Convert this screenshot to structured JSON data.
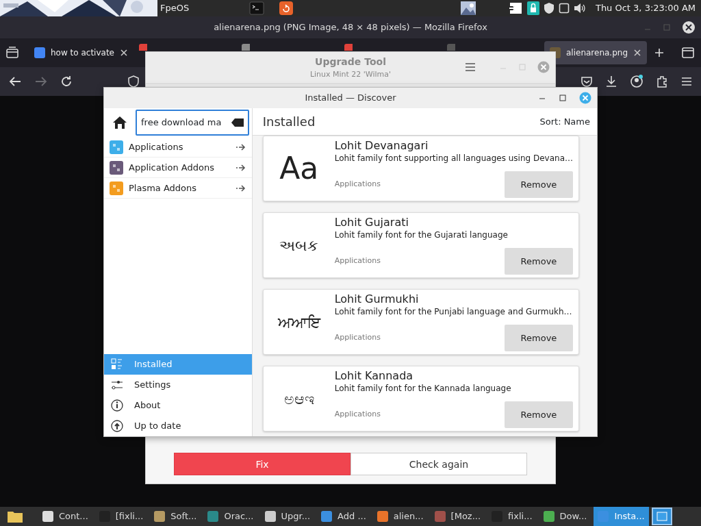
{
  "top_panel": {
    "app_label": "FpeOS",
    "clock": "Thu Oct 3, 3:23:00 AM"
  },
  "firefox": {
    "title": "alienarena.png (PNG Image, 48 × 48 pixels) — Mozilla Firefox",
    "tabs": [
      {
        "label": "how to activate",
        "selected": false,
        "color": "#4285f4"
      },
      {
        "selected": false,
        "color": "#e0413a"
      },
      {
        "selected": false,
        "color": "#8a8a8a"
      },
      {
        "selected": false,
        "color": "#e0413a"
      },
      {
        "selected": false,
        "color": "#555555"
      },
      {
        "label": "alienarena.png",
        "selected": true,
        "color": "#6b5a3a"
      }
    ]
  },
  "upgrade_tool": {
    "title": "Upgrade Tool",
    "subtitle": "Linux Mint 22 'Wilma'",
    "buttons": [
      {
        "label": "Fix",
        "kind": "danger"
      },
      {
        "label": "Check again",
        "kind": "plain"
      }
    ]
  },
  "discover": {
    "title": "Installed — Discover",
    "search": {
      "value": "free download ma"
    },
    "categories": [
      {
        "label": "Applications",
        "color": "#3daee9"
      },
      {
        "label": "Application Addons",
        "color": "#6a5a7a"
      },
      {
        "label": "Plasma Addons",
        "color": "#f39c1f"
      }
    ],
    "nav": [
      {
        "label": "Installed",
        "selected": true,
        "kind": "installed"
      },
      {
        "label": "Settings",
        "selected": false,
        "kind": "settings"
      },
      {
        "label": "About",
        "selected": false,
        "kind": "about"
      },
      {
        "label": "Up to date",
        "selected": false,
        "kind": "update"
      }
    ],
    "header": "Installed",
    "sort": "Sort: Name",
    "apps": [
      {
        "name": "Lohit Devanagari",
        "description": "Lohit family font supporting all languages using Devana…",
        "category": "Applications",
        "preview": "Aa",
        "action": "Remove"
      },
      {
        "name": "Lohit Gujarati",
        "description": "Lohit family font for the Gujarati language",
        "category": "Applications",
        "preview": "અબક",
        "action": "Remove"
      },
      {
        "name": "Lohit Gurmukhi",
        "description": "Lohit family font for the Punjabi language and Gurmukh…",
        "category": "Applications",
        "preview": "ਅਆਇ",
        "action": "Remove"
      },
      {
        "name": "Lohit Kannada",
        "description": "Lohit family font for the Kannada language",
        "category": "Applications",
        "preview": "ಅಆಇ",
        "action": "Remove"
      }
    ]
  },
  "taskbar": {
    "items": [
      {
        "label": "Cont...",
        "selected": false,
        "color": "#dddddd"
      },
      {
        "label": "[fixli...",
        "selected": false,
        "color": "#222222"
      },
      {
        "label": "Soft...",
        "selected": false,
        "color": "#b59a63"
      },
      {
        "label": "Orac...",
        "selected": false,
        "color": "#2a8a8a"
      },
      {
        "label": "Upgr...",
        "selected": false,
        "color": "#cccccc"
      },
      {
        "label": "Add ...",
        "selected": false,
        "color": "#3b8fe0"
      },
      {
        "label": "alien...",
        "selected": false,
        "color": "#e8732a"
      },
      {
        "label": "[Moz...",
        "selected": false,
        "color": "#a0504a"
      },
      {
        "label": "fixli...",
        "selected": false,
        "color": "#222222"
      },
      {
        "label": "Dow...",
        "selected": false,
        "color": "#4caf50"
      },
      {
        "label": "Insta...",
        "selected": true,
        "color": "#3b8fe0"
      }
    ]
  }
}
